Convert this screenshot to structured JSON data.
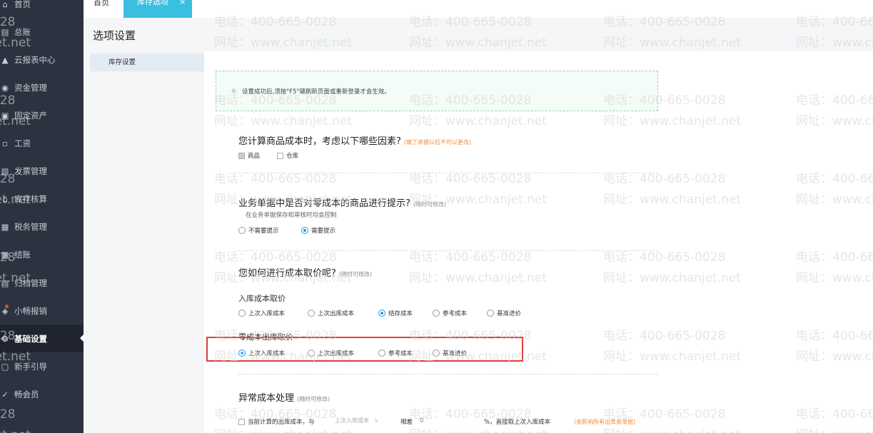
{
  "sidebar": {
    "items": [
      {
        "label": "首页",
        "icon": "home-icon"
      },
      {
        "label": "总账",
        "icon": "ledger-icon"
      },
      {
        "label": "云报表中心",
        "icon": "chart-icon"
      },
      {
        "label": "资金管理",
        "icon": "fund-icon"
      },
      {
        "label": "固定资产",
        "icon": "asset-icon"
      },
      {
        "label": "工资",
        "icon": "salary-icon"
      },
      {
        "label": "发票管理",
        "icon": "invoice-icon"
      },
      {
        "label": "库存核算",
        "icon": "warehouse-icon"
      },
      {
        "label": "税务管理",
        "icon": "tax-icon"
      },
      {
        "label": "结账",
        "icon": "close-books-icon"
      },
      {
        "label": "归档管理",
        "icon": "archive-icon"
      },
      {
        "label": "小畅报销",
        "icon": "reimburse-icon"
      },
      {
        "label": "基础设置",
        "icon": "gear-icon",
        "active": true
      },
      {
        "label": "新手引导",
        "icon": "guide-icon"
      },
      {
        "label": "畅会员",
        "icon": "member-icon"
      }
    ]
  },
  "tabs": {
    "home": "首页",
    "active": "库存选项",
    "close": "×"
  },
  "page": {
    "title": "选项设置"
  },
  "subnav": {
    "item": "库存设置"
  },
  "notice": {
    "text": "设置成功后,须按\"F5\"键刷新页面或重新登录才会生效。"
  },
  "section1": {
    "question": "您计算商品成本时，考虑以下哪些因素?",
    "hint": "(填了单据以后不可以更改)",
    "options": [
      {
        "label": "商品",
        "checked": true
      },
      {
        "label": "仓库",
        "checked": false
      }
    ]
  },
  "section2": {
    "question": "业务单据中是否对零成本的商品进行提示?",
    "hint": "(随时可修改)",
    "sub": "在业务单据保存和审核时均会控制",
    "options": [
      {
        "label": "不需要提示",
        "checked": false
      },
      {
        "label": "需要提示",
        "checked": true
      }
    ]
  },
  "section3": {
    "question": "您如何进行成本取价呢?",
    "hint": "(随时可修改)",
    "inbound_label": "入库成本取价",
    "inbound_options": [
      {
        "label": "上次入库成本",
        "checked": false
      },
      {
        "label": "上次出库成本",
        "checked": false
      },
      {
        "label": "结存成本",
        "checked": true
      },
      {
        "label": "参考成本",
        "checked": false
      },
      {
        "label": "基准进价",
        "checked": false
      }
    ],
    "zero_label": "零成本出库取价",
    "zero_options": [
      {
        "label": "上次入库成本",
        "checked": true
      },
      {
        "label": "上次出库成本",
        "checked": false
      },
      {
        "label": "参考成本",
        "checked": false
      },
      {
        "label": "基准进价",
        "checked": false
      }
    ]
  },
  "section4": {
    "question": "异常成本处理",
    "hint": "(随时可修改)",
    "row_text": "当前计算的出库成本，与",
    "select_value": "上次入库成本",
    "diff_label": "相差",
    "diff_value": "0",
    "tail_text": "%，直接取上次入库成本",
    "red_note": "(会影响所有出库类单据)"
  },
  "watermark": {
    "phone": "电话：400-665-0028",
    "site": "网址：www.chanjet.net"
  },
  "colors": {
    "sidebar_bg": "#2c3240",
    "tab_active": "#3bbfe0",
    "radio_checked": "#1f9af1",
    "highlight": "#e23b3b"
  }
}
